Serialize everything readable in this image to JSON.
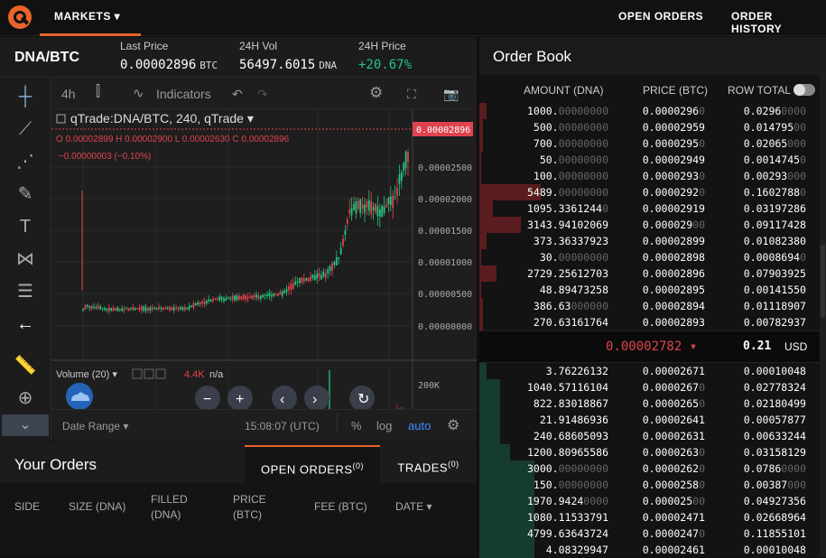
{
  "nav": {
    "markets": "MARKETS ▾",
    "open_orders": "OPEN ORDERS",
    "order_history": "ORDER HISTORY"
  },
  "ticker": {
    "pair": "DNA/BTC",
    "last_price_label": "Last Price",
    "last_price": "0.00002896",
    "last_price_unit": "BTC",
    "vol_label": "24H Vol",
    "vol": "56497.6015",
    "vol_unit": "DNA",
    "change_label": "24H Price",
    "change": "+20.67%"
  },
  "chart": {
    "interval": "4h",
    "indicators": "Indicators",
    "legend_title": "qTrade:DNA/BTC, 240, qTrade ▾",
    "ohlc": {
      "o_label": "O",
      "o": "0.00002899",
      "h_label": "H",
      "h": "0.00002900",
      "l_label": "L",
      "l": "0.00002630",
      "c_label": "C",
      "c": "0.00002896"
    },
    "change_line": "−0.00000003 (−0.10%)",
    "price_tag": "0.00002896",
    "price_ticks": [
      "0.00002500",
      "0.00002000",
      "0.00001500",
      "0.00001000",
      "0.00000500",
      "0.00000000"
    ],
    "volume_label": "Volume (20) ▾",
    "volume_value": "4.4K",
    "volume_na": "n/a",
    "vol_ticks": [
      "200K",
      "0"
    ],
    "x_ticks": [
      "4",
      "12",
      "20",
      "Mar",
      "9"
    ],
    "date_range": "Date Range ▾",
    "time": "15:08:07 (UTC)",
    "pct": "%",
    "log": "log",
    "auto": "auto",
    "colors": {
      "up": "#26c281",
      "down": "#e0434e",
      "accent": "#3b8dff"
    }
  },
  "chart_data": {
    "type": "line",
    "x": [
      "4",
      "12",
      "20",
      "Mar",
      "9"
    ],
    "series": [
      {
        "values": [
          3.2e-06,
          3.5e-06,
          5e-06,
          7.8e-06,
          2.9e-05
        ]
      }
    ],
    "ylim": [
      0,
      3e-05
    ]
  },
  "your_orders": {
    "title": "Your Orders",
    "tab_open": "OPEN ORDERS",
    "tab_open_count": "(0)",
    "tab_trades": "TRADES",
    "tab_trades_count": "(0)",
    "columns": [
      "SIDE",
      "SIZE (DNA)",
      "FILLED (DNA)",
      "PRICE (BTC)",
      "FEE (BTC)",
      "DATE ▾"
    ]
  },
  "order_book": {
    "title": "Order Book",
    "col_amount": "AMOUNT (DNA)",
    "col_price": "PRICE (BTC)",
    "col_total": "ROW TOTAL",
    "asks": [
      {
        "a": "1000.",
        "ad": "00000000",
        "p": "0.0000296",
        "pd": "0",
        "t": "0.0296",
        "td": "0000",
        "d": 0.02
      },
      {
        "a": "500.",
        "ad": "00000000",
        "p": "0.00002959",
        "pd": "",
        "t": "0.014795",
        "td": "00",
        "d": 0.01
      },
      {
        "a": "700.",
        "ad": "00000000",
        "p": "0.0000295",
        "pd": "0",
        "t": "0.02065",
        "td": "000",
        "d": 0.01
      },
      {
        "a": "50.",
        "ad": "00000000",
        "p": "0.00002949",
        "pd": "",
        "t": "0.0014745",
        "td": "0",
        "d": 0.005
      },
      {
        "a": "100.",
        "ad": "00000000",
        "p": "0.0000293",
        "pd": "0",
        "t": "0.00293",
        "td": "000",
        "d": 0.005
      },
      {
        "a": "5489.",
        "ad": "00000000",
        "p": "0.0000292",
        "pd": "0",
        "t": "0.1602788",
        "td": "0",
        "d": 0.18
      },
      {
        "a": "1095.3361244",
        "ad": "0",
        "p": "0.00002919",
        "pd": "",
        "t": "0.03197286",
        "td": "",
        "d": 0.04
      },
      {
        "a": "3143.94102069",
        "ad": "",
        "p": "0.000029",
        "pd": "00",
        "t": "0.09117428",
        "td": "",
        "d": 0.12
      },
      {
        "a": "373.36337923",
        "ad": "",
        "p": "0.00002899",
        "pd": "",
        "t": "0.01082380",
        "td": "",
        "d": 0.02
      },
      {
        "a": "30.",
        "ad": "00000000",
        "p": "0.00002898",
        "pd": "",
        "t": "0.0008694",
        "td": "0",
        "d": 0.005
      },
      {
        "a": "2729.25612703",
        "ad": "",
        "p": "0.00002896",
        "pd": "",
        "t": "0.07903925",
        "td": "",
        "d": 0.05
      },
      {
        "a": "48.89473258",
        "ad": "",
        "p": "0.00002895",
        "pd": "",
        "t": "0.00141550",
        "td": "",
        "d": 0.005
      },
      {
        "a": "386.63",
        "ad": "000000",
        "p": "0.00002894",
        "pd": "",
        "t": "0.01118907",
        "td": "",
        "d": 0.01
      },
      {
        "a": "270.63161764",
        "ad": "",
        "p": "0.00002893",
        "pd": "",
        "t": "0.00782937",
        "td": "",
        "d": 0.01
      }
    ],
    "spread_price": "0.00002782",
    "spread_total": "0.21",
    "spread_unit": "USD",
    "bids": [
      {
        "a": "3.76226132",
        "ad": "",
        "p": "0.00002671",
        "pd": "",
        "t": "0.00010048",
        "td": "",
        "d": 0.02
      },
      {
        "a": "1040.57116104",
        "ad": "",
        "p": "0.0000267",
        "pd": "0",
        "t": "0.02778324",
        "td": "",
        "d": 0.06
      },
      {
        "a": "822.83018867",
        "ad": "",
        "p": "0.0000265",
        "pd": "0",
        "t": "0.02180499",
        "td": "",
        "d": 0.06
      },
      {
        "a": "21.91486936",
        "ad": "",
        "p": "0.00002641",
        "pd": "",
        "t": "0.00057877",
        "td": "",
        "d": 0.06
      },
      {
        "a": "240.68605093",
        "ad": "",
        "p": "0.00002631",
        "pd": "",
        "t": "0.00633244",
        "td": "",
        "d": 0.06
      },
      {
        "a": "1200.80965586",
        "ad": "",
        "p": "0.0000263",
        "pd": "0",
        "t": "0.03158129",
        "td": "",
        "d": 0.09
      },
      {
        "a": "3000.",
        "ad": "00000000",
        "p": "0.0000262",
        "pd": "0",
        "t": "0.0786",
        "td": "0000",
        "d": 0.16
      },
      {
        "a": "150.",
        "ad": "00000000",
        "p": "0.0000258",
        "pd": "0",
        "t": "0.00387",
        "td": "000",
        "d": 0.16
      },
      {
        "a": "1970.9424",
        "ad": "0000",
        "p": "0.000025",
        "pd": "00",
        "t": "0.04927356",
        "td": "",
        "d": 0.16
      },
      {
        "a": "1080.11533791",
        "ad": "",
        "p": "0.00002471",
        "pd": "",
        "t": "0.02668964",
        "td": "",
        "d": 0.16
      },
      {
        "a": "4799.63643724",
        "ad": "",
        "p": "0.0000247",
        "pd": "0",
        "t": "0.11855101",
        "td": "",
        "d": 0.16
      },
      {
        "a": "4.08329947",
        "ad": "",
        "p": "0.00002461",
        "pd": "",
        "t": "0.00010048",
        "td": "",
        "d": 0.16
      }
    ]
  }
}
